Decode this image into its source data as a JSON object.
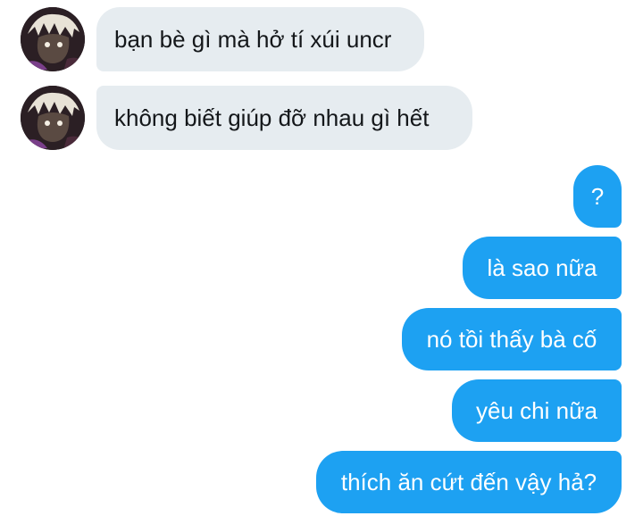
{
  "colors": {
    "incoming_bubble": "#e6ecf0",
    "incoming_text": "#14171a",
    "outgoing_bubble": "#1da1f2",
    "outgoing_text": "#ffffff"
  },
  "conversation": {
    "incoming": [
      {
        "text": "bạn bè gì mà hở tí xúi uncr",
        "avatar_icon": "user-avatar"
      },
      {
        "text": "không biết giúp đỡ nhau gì hết",
        "avatar_icon": "user-avatar"
      }
    ],
    "outgoing": [
      {
        "text": "?"
      },
      {
        "text": "là sao nữa"
      },
      {
        "text": "nó tồi thấy bà cố"
      },
      {
        "text": "yêu chi nữa"
      },
      {
        "text": "thích ăn cứt đến vậy hả?"
      }
    ]
  }
}
